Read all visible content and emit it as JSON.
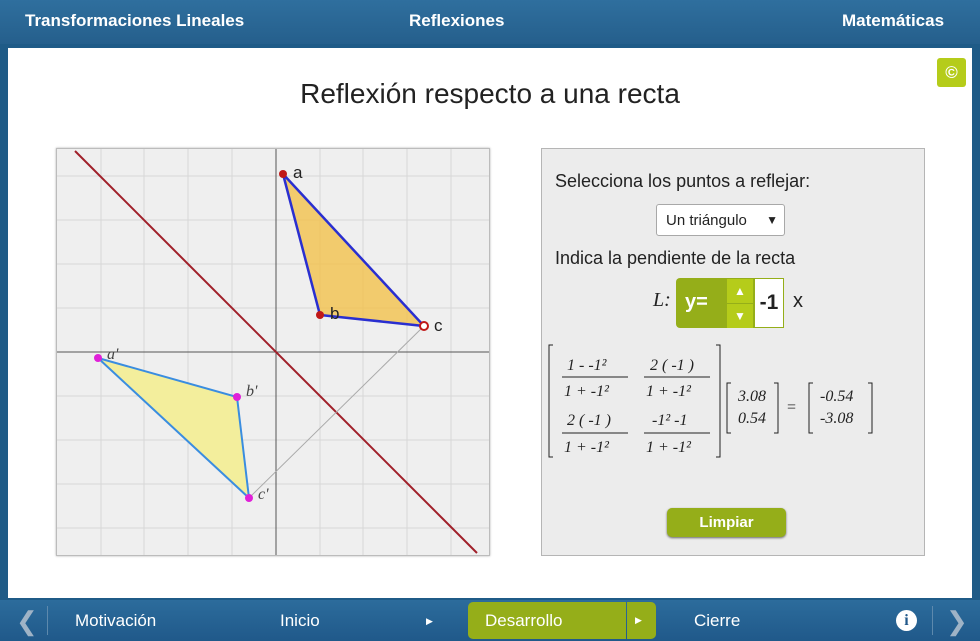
{
  "header": {
    "left_title": "Transformaciones Lineales",
    "center_title": "Reflexiones",
    "right_title": "Matemáticas"
  },
  "main": {
    "title": "Reflexión respecto a una recta",
    "copyright_symbol": "©"
  },
  "graph": {
    "labels": {
      "a": "a",
      "b": "b",
      "c": "c",
      "a_prime": "a'",
      "b_prime": "b'",
      "c_prime": "c'"
    },
    "colors": {
      "line": "#a0202a",
      "triangle_fill": "#f2c24c",
      "triangle_edge": "#2a2fd0",
      "reflected_fill": "#f3ee9c",
      "reflected_edge": "#3a8de0",
      "reflected_point": "#e020d8",
      "point": "#c01818"
    }
  },
  "panel": {
    "select_label": "Selecciona los puntos a reflejar:",
    "select_value": "Un triángulo",
    "slope_label": "Indica la pendiente de la recta",
    "L_label": "L:",
    "y_eq": "y=",
    "slope_value": "-1",
    "x_var": "x",
    "clear_label": "Limpiar",
    "matrix": {
      "m11": "1 - -1²",
      "m11_den": "1 + -1²",
      "m12": "2 ( -1 )",
      "m12_den": "1 + -1²",
      "m21": "2 ( -1 )",
      "m21_den": "1 + -1²",
      "m22": "-1² -1",
      "m22_den": "1 + -1²",
      "v1": "3.08",
      "v2": "0.54",
      "eq": "=",
      "r1": "-0.54",
      "r2": "-3.08"
    }
  },
  "nav": {
    "prev_icon": "chevron-left-icon",
    "items": [
      "Motivación",
      "Inicio",
      "Desarrollo",
      "Cierre"
    ],
    "submenu_icon": "triangle-right-icon",
    "info_symbol": "i",
    "next_icon": "chevron-right-icon"
  }
}
